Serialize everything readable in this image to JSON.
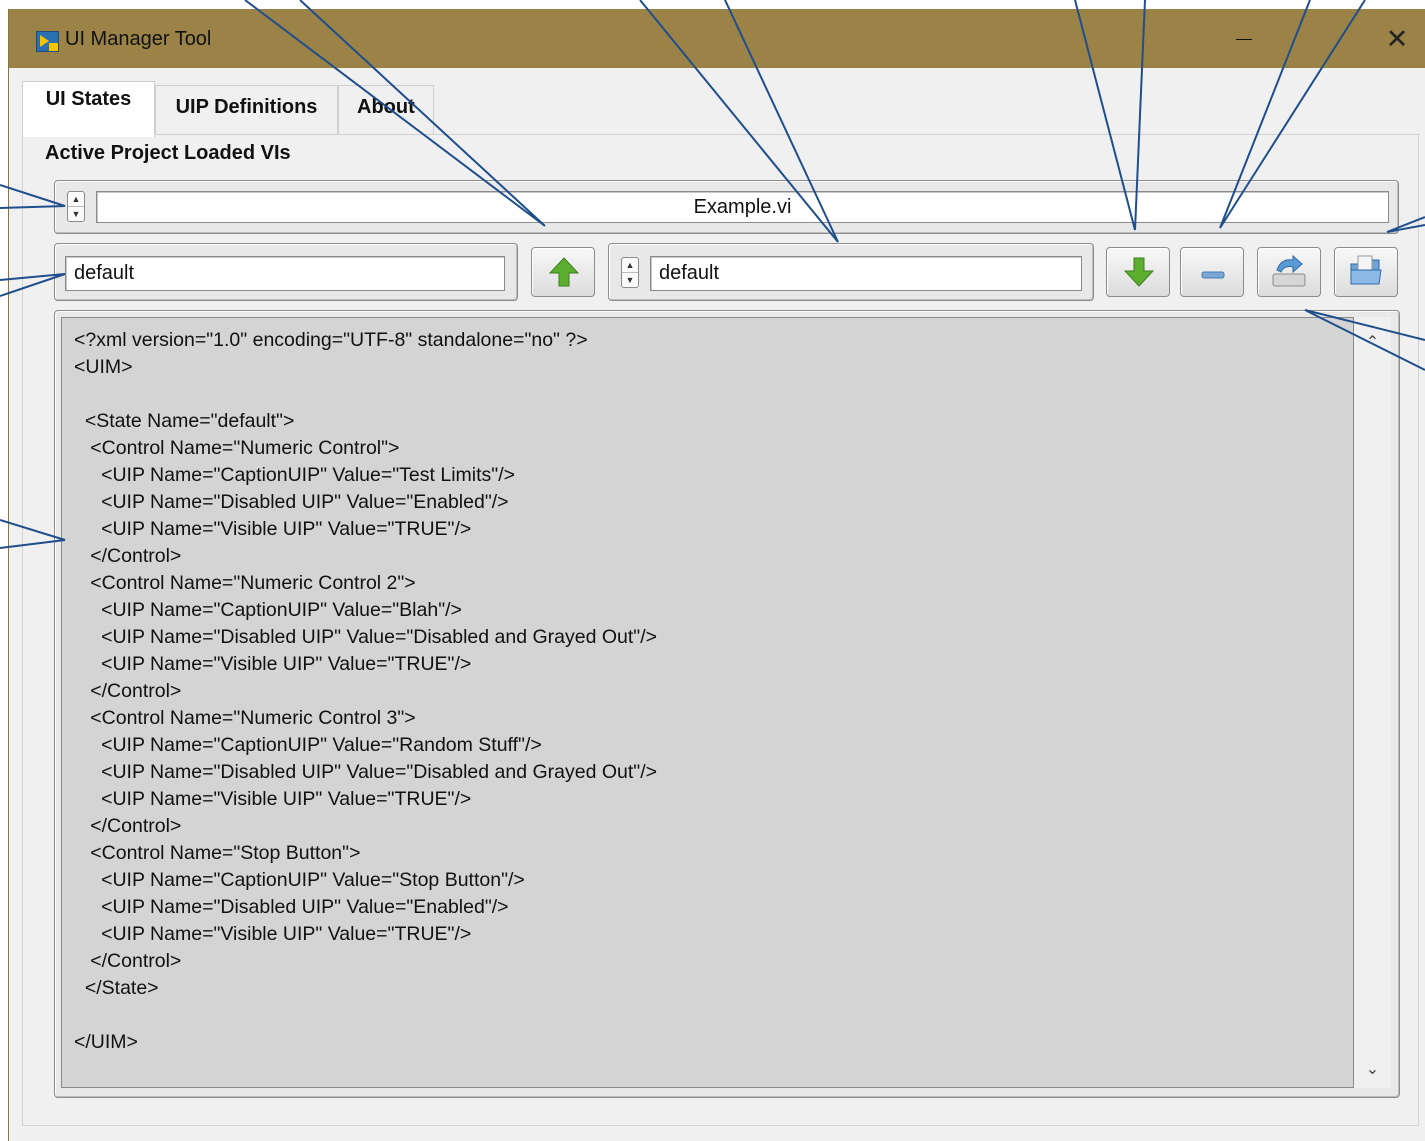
{
  "window": {
    "title": "UI Manager Tool"
  },
  "tabs": [
    {
      "label": "UI States"
    },
    {
      "label": "UIP Definitions"
    },
    {
      "label": "About"
    }
  ],
  "section_label": "Active Project Loaded VIs",
  "vi_selector": {
    "value": "Example.vi"
  },
  "state_name_input": {
    "value": "default"
  },
  "state_selector": {
    "value": "default"
  },
  "icons": {
    "app": "labview-app-icon",
    "minimize": "minimize-icon",
    "close": "close-icon",
    "upload": "green-up-arrow-icon",
    "download": "green-down-arrow-icon",
    "remove": "minus-icon",
    "save": "save-tray-arrow-icon",
    "open": "open-folder-icon"
  },
  "xml_content": "<?xml version=\"1.0\" encoding=\"UTF-8\" standalone=\"no\" ?>\n<UIM>\n\n  <State Name=\"default\">\n   <Control Name=\"Numeric Control\">\n     <UIP Name=\"CaptionUIP\" Value=\"Test Limits\"/>\n     <UIP Name=\"Disabled UIP\" Value=\"Enabled\"/>\n     <UIP Name=\"Visible UIP\" Value=\"TRUE\"/>\n   </Control>\n   <Control Name=\"Numeric Control 2\">\n     <UIP Name=\"CaptionUIP\" Value=\"Blah\"/>\n     <UIP Name=\"Disabled UIP\" Value=\"Disabled and Grayed Out\"/>\n     <UIP Name=\"Visible UIP\" Value=\"TRUE\"/>\n   </Control>\n   <Control Name=\"Numeric Control 3\">\n     <UIP Name=\"CaptionUIP\" Value=\"Random Stuff\"/>\n     <UIP Name=\"Disabled UIP\" Value=\"Disabled and Grayed Out\"/>\n     <UIP Name=\"Visible UIP\" Value=\"TRUE\"/>\n   </Control>\n   <Control Name=\"Stop Button\">\n     <UIP Name=\"CaptionUIP\" Value=\"Stop Button\"/>\n     <UIP Name=\"Disabled UIP\" Value=\"Enabled\"/>\n     <UIP Name=\"Visible UIP\" Value=\"TRUE\"/>\n   </Control>\n  </State>\n\n</UIM>",
  "colors": {
    "titlebar": "#9b8347",
    "callout": "#1f4e8c",
    "editor_background": "#d4d4d4",
    "arrow_green": "#5cae2e"
  }
}
